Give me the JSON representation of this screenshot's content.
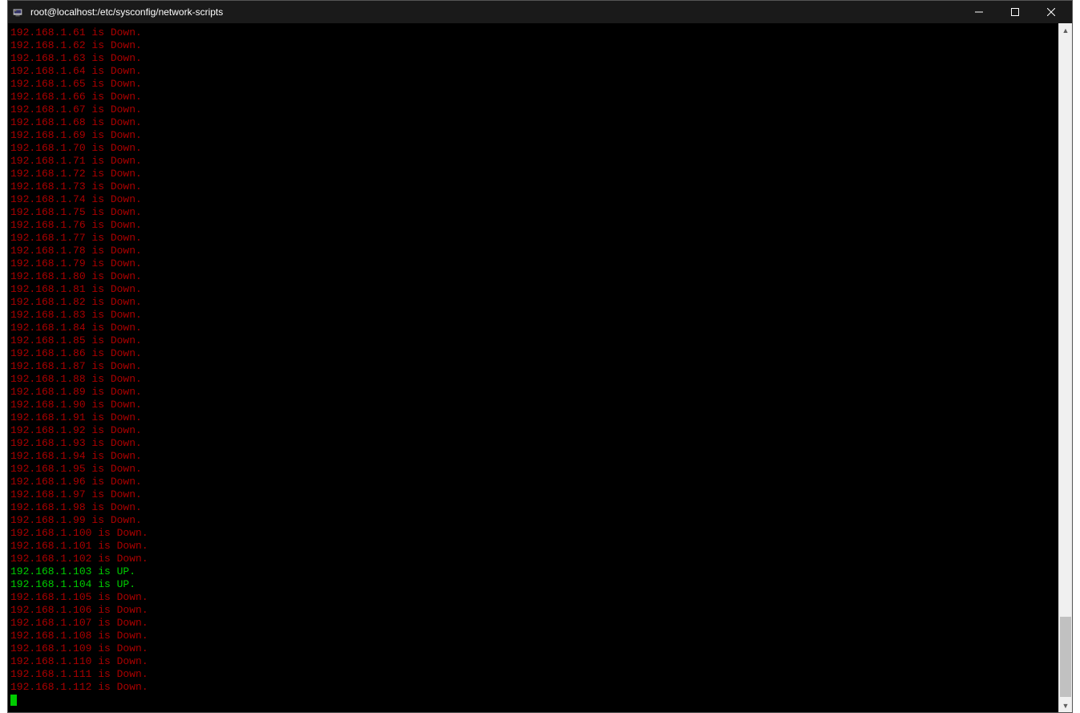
{
  "titlebar": {
    "title": "root@localhost:/etc/sysconfig/network-scripts"
  },
  "terminal": {
    "lines": [
      {
        "text": "192.168.1.61 is Down.",
        "status": "down"
      },
      {
        "text": "192.168.1.62 is Down.",
        "status": "down"
      },
      {
        "text": "192.168.1.63 is Down.",
        "status": "down"
      },
      {
        "text": "192.168.1.64 is Down.",
        "status": "down"
      },
      {
        "text": "192.168.1.65 is Down.",
        "status": "down"
      },
      {
        "text": "192.168.1.66 is Down.",
        "status": "down"
      },
      {
        "text": "192.168.1.67 is Down.",
        "status": "down"
      },
      {
        "text": "192.168.1.68 is Down.",
        "status": "down"
      },
      {
        "text": "192.168.1.69 is Down.",
        "status": "down"
      },
      {
        "text": "192.168.1.70 is Down.",
        "status": "down"
      },
      {
        "text": "192.168.1.71 is Down.",
        "status": "down"
      },
      {
        "text": "192.168.1.72 is Down.",
        "status": "down"
      },
      {
        "text": "192.168.1.73 is Down.",
        "status": "down"
      },
      {
        "text": "192.168.1.74 is Down.",
        "status": "down"
      },
      {
        "text": "192.168.1.75 is Down.",
        "status": "down"
      },
      {
        "text": "192.168.1.76 is Down.",
        "status": "down"
      },
      {
        "text": "192.168.1.77 is Down.",
        "status": "down"
      },
      {
        "text": "192.168.1.78 is Down.",
        "status": "down"
      },
      {
        "text": "192.168.1.79 is Down.",
        "status": "down"
      },
      {
        "text": "192.168.1.80 is Down.",
        "status": "down"
      },
      {
        "text": "192.168.1.81 is Down.",
        "status": "down"
      },
      {
        "text": "192.168.1.82 is Down.",
        "status": "down"
      },
      {
        "text": "192.168.1.83 is Down.",
        "status": "down"
      },
      {
        "text": "192.168.1.84 is Down.",
        "status": "down"
      },
      {
        "text": "192.168.1.85 is Down.",
        "status": "down"
      },
      {
        "text": "192.168.1.86 is Down.",
        "status": "down"
      },
      {
        "text": "192.168.1.87 is Down.",
        "status": "down"
      },
      {
        "text": "192.168.1.88 is Down.",
        "status": "down"
      },
      {
        "text": "192.168.1.89 is Down.",
        "status": "down"
      },
      {
        "text": "192.168.1.90 is Down.",
        "status": "down"
      },
      {
        "text": "192.168.1.91 is Down.",
        "status": "down"
      },
      {
        "text": "192.168.1.92 is Down.",
        "status": "down"
      },
      {
        "text": "192.168.1.93 is Down.",
        "status": "down"
      },
      {
        "text": "192.168.1.94 is Down.",
        "status": "down"
      },
      {
        "text": "192.168.1.95 is Down.",
        "status": "down"
      },
      {
        "text": "192.168.1.96 is Down.",
        "status": "down"
      },
      {
        "text": "192.168.1.97 is Down.",
        "status": "down"
      },
      {
        "text": "192.168.1.98 is Down.",
        "status": "down"
      },
      {
        "text": "192.168.1.99 is Down.",
        "status": "down"
      },
      {
        "text": "192.168.1.100 is Down.",
        "status": "down"
      },
      {
        "text": "192.168.1.101 is Down.",
        "status": "down"
      },
      {
        "text": "192.168.1.102 is Down.",
        "status": "down"
      },
      {
        "text": "192.168.1.103 is UP.",
        "status": "up"
      },
      {
        "text": "192.168.1.104 is UP.",
        "status": "up"
      },
      {
        "text": "192.168.1.105 is Down.",
        "status": "down"
      },
      {
        "text": "192.168.1.106 is Down.",
        "status": "down"
      },
      {
        "text": "192.168.1.107 is Down.",
        "status": "down"
      },
      {
        "text": "192.168.1.108 is Down.",
        "status": "down"
      },
      {
        "text": "192.168.1.109 is Down.",
        "status": "down"
      },
      {
        "text": "192.168.1.110 is Down.",
        "status": "down"
      },
      {
        "text": "192.168.1.111 is Down.",
        "status": "down"
      },
      {
        "text": "192.168.1.112 is Down.",
        "status": "down"
      }
    ]
  }
}
